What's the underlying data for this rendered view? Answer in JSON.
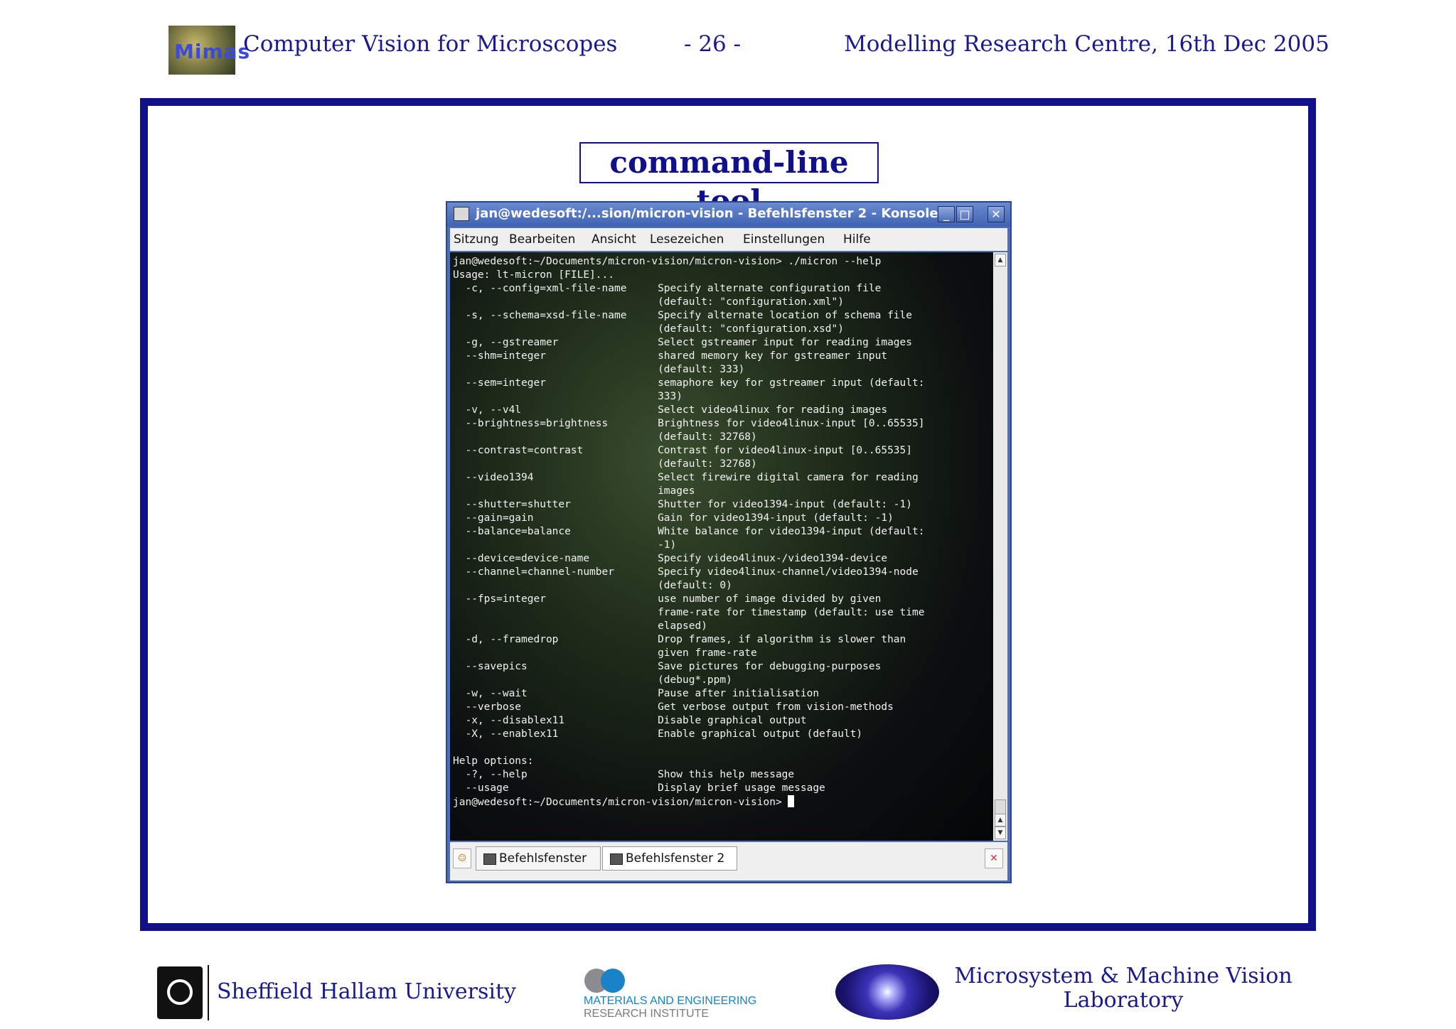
{
  "header": {
    "logo_text": "Mimas",
    "left_title": "Computer Vision for Microscopes",
    "page_number": "- 26 -",
    "right_title": "Modelling Research Centre, 16th Dec 2005"
  },
  "slide": {
    "title": "command-line tool"
  },
  "window": {
    "title": "jan@wedesoft:/...sion/micron-vision - Befehlsfenster 2 - Konsole",
    "controls": {
      "minimize": "_",
      "maximize": "□",
      "close": "✕"
    },
    "menu": [
      "Sitzung",
      "Bearbeiten",
      "Ansicht",
      "Lesezeichen",
      "Einstellungen",
      "Hilfe"
    ],
    "terminal": {
      "text": "jan@wedesoft:~/Documents/micron-vision/micron-vision> ./micron --help\nUsage: lt-micron [FILE]...\n  -c, --config=xml-file-name     Specify alternate configuration file\n                                 (default: \"configuration.xml\")\n  -s, --schema=xsd-file-name     Specify alternate location of schema file\n                                 (default: \"configuration.xsd\")\n  -g, --gstreamer                Select gstreamer input for reading images\n  --shm=integer                  shared memory key for gstreamer input\n                                 (default: 333)\n  --sem=integer                  semaphore key for gstreamer input (default:\n                                 333)\n  -v, --v4l                      Select video4linux for reading images\n  --brightness=brightness        Brightness for video4linux-input [0..65535]\n                                 (default: 32768)\n  --contrast=contrast            Contrast for video4linux-input [0..65535]\n                                 (default: 32768)\n  --video1394                    Select firewire digital camera for reading\n                                 images\n  --shutter=shutter              Shutter for video1394-input (default: -1)\n  --gain=gain                    Gain for video1394-input (default: -1)\n  --balance=balance              White balance for video1394-input (default:\n                                 -1)\n  --device=device-name           Specify video4linux-/video1394-device\n  --channel=channel-number       Specify video4linux-channel/video1394-node\n                                 (default: 0)\n  --fps=integer                  use number of image divided by given\n                                 frame-rate for timestamp (default: use time\n                                 elapsed)\n  -d, --framedrop                Drop frames, if algorithm is slower than\n                                 given frame-rate\n  --savepics                     Save pictures for debugging-purposes\n                                 (debug*.ppm)\n  -w, --wait                     Pause after initialisation\n  --verbose                      Get verbose output from vision-methods\n  -x, --disablex11               Disable graphical output\n  -X, --enablex11                Enable graphical output (default)\n\nHelp options:\n  -?, --help                     Show this help message\n  --usage                        Display brief usage message\njan@wedesoft:~/Documents/micron-vision/micron-vision> "
    },
    "tabs": [
      "Befehlsfenster",
      "Befehlsfenster 2"
    ],
    "active_tab": "Befehlsfenster 2",
    "colors": {
      "titlebar": "#4f6fb8",
      "terminal_text": "#f2f2f2",
      "frame": "#10108a"
    }
  },
  "footer": {
    "left": "Sheffield Hallam University",
    "middle_line1": "MATERIALS AND ENGINEERING",
    "middle_line2": "RESEARCH INSTITUTE",
    "right": "Microsystem & Machine Vision Laboratory"
  }
}
